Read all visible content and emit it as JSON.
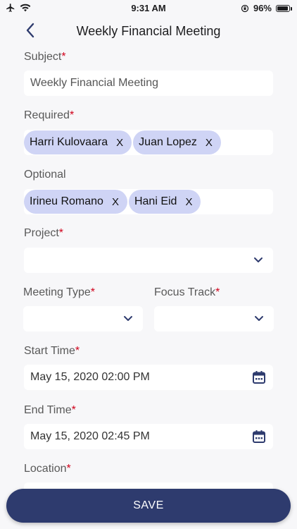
{
  "status": {
    "time": "9:31 AM",
    "battery": "96%",
    "battery_level": 0.96
  },
  "header": {
    "title": "Weekly Financial Meeting"
  },
  "form": {
    "required_mark": "*",
    "subject": {
      "label": "Subject",
      "value": "Weekly Financial Meeting"
    },
    "required": {
      "label": "Required",
      "chips": [
        "Harri Kulovaara",
        "Juan Lopez"
      ]
    },
    "optional": {
      "label": "Optional",
      "chips": [
        "Irineu Romano",
        "Hani Eid"
      ]
    },
    "chip_remove": "X",
    "project": {
      "label": "Project",
      "value": ""
    },
    "meeting_type": {
      "label": "Meeting Type",
      "value": ""
    },
    "focus_track": {
      "label": "Focus Track",
      "value": ""
    },
    "start_time": {
      "label": "Start Time",
      "value": "May 15, 2020 02:00 PM"
    },
    "end_time": {
      "label": "End Time",
      "value": "May 15, 2020 02:45 PM"
    },
    "location": {
      "label": "Location"
    }
  },
  "actions": {
    "save_label": "SAVE"
  },
  "colors": {
    "accent": "#2e3b6e",
    "chip": "#cfd4f5",
    "required": "#d0021b"
  },
  "icons": [
    "airplane-icon",
    "wifi-icon",
    "orientation-lock-icon",
    "battery-icon",
    "back-chevron-icon",
    "chevron-down-icon",
    "calendar-icon"
  ]
}
